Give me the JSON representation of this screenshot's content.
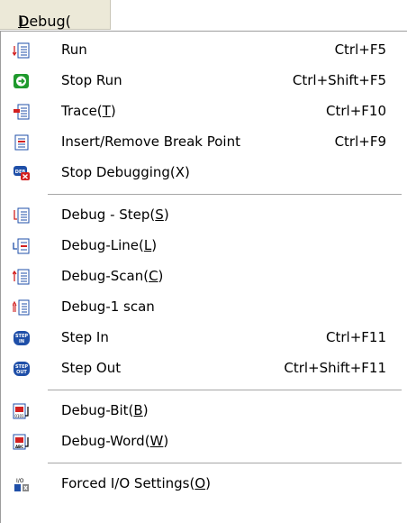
{
  "menubar": {
    "title": "Debug(",
    "mnemonic": "D",
    "suffix": ")"
  },
  "items": [
    {
      "pre": "Run",
      "mn": "",
      "post": "",
      "shortcut": "Ctrl+F5",
      "icon": "run-icon"
    },
    {
      "pre": "Stop Run",
      "mn": "",
      "post": "",
      "shortcut": "Ctrl+Shift+F5",
      "icon": "stop-run-icon"
    },
    {
      "pre": "Trace(",
      "mn": "T",
      "post": ")",
      "shortcut": "Ctrl+F10",
      "icon": "trace-icon"
    },
    {
      "pre": "Insert/Remove Break Point",
      "mn": "",
      "post": "",
      "shortcut": "Ctrl+F9",
      "icon": "breakpoint-icon"
    },
    {
      "pre": "Stop Debugging(X)",
      "mn": "",
      "post": "",
      "shortcut": "",
      "icon": "stop-debugging-icon"
    },
    {
      "pre": "Debug - Step(",
      "mn": "S",
      "post": ")",
      "shortcut": "",
      "icon": "debug-step-icon"
    },
    {
      "pre": "Debug-Line(",
      "mn": "L",
      "post": ")",
      "shortcut": "",
      "icon": "debug-line-icon"
    },
    {
      "pre": "Debug-Scan(",
      "mn": "C",
      "post": ")",
      "shortcut": "",
      "icon": "debug-scan-icon"
    },
    {
      "pre": "Debug-1 scan",
      "mn": "",
      "post": "",
      "shortcut": "",
      "icon": "debug-1-scan-icon"
    },
    {
      "pre": "Step In",
      "mn": "",
      "post": "",
      "shortcut": "Ctrl+F11",
      "icon": "step-in-icon"
    },
    {
      "pre": "Step Out",
      "mn": "",
      "post": "",
      "shortcut": "Ctrl+Shift+F11",
      "icon": "step-out-icon"
    },
    {
      "pre": "Debug-Bit(",
      "mn": "B",
      "post": ")",
      "shortcut": "",
      "icon": "debug-bit-icon"
    },
    {
      "pre": "Debug-Word(",
      "mn": "W",
      "post": ")",
      "shortcut": "",
      "icon": "debug-word-icon"
    },
    {
      "pre": "Forced I/O Settings(",
      "mn": "O",
      "post": ")",
      "shortcut": "",
      "icon": "forced-io-icon"
    }
  ],
  "icon_badges": {
    "deb": "DEB",
    "step": "STEP",
    "in": "IN",
    "out": "OUT",
    "bit": "0101",
    "word": "ABC",
    "io": "I/O"
  },
  "colors": {
    "menubar_bg": "#ece9d8",
    "separator": "#a6a6a6",
    "blue": "#1f4fa8",
    "red": "#d22020",
    "green": "#1f9a2d"
  }
}
